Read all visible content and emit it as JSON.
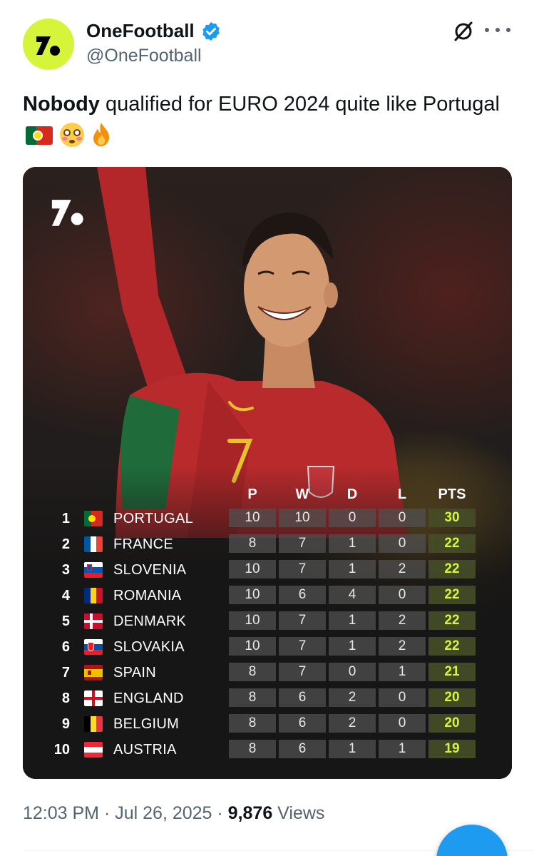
{
  "author": {
    "display_name": "OneFootball",
    "handle": "@OneFootball",
    "verified": true,
    "avatar_icon": "onefootball-logo-icon",
    "brand_color": "#d6f53a"
  },
  "tweet": {
    "bold_word": "Nobody",
    "text": " qualified for EURO 2024 quite like Portugal",
    "emojis": [
      "portugal-flag",
      "flushed-face",
      "fire"
    ]
  },
  "table": {
    "headers": [
      "P",
      "W",
      "D",
      "L",
      "PTS"
    ],
    "rows": [
      {
        "pos": "1",
        "team": "PORTUGAL",
        "flag": "portugal",
        "p": "10",
        "w": "10",
        "d": "0",
        "l": "0",
        "pts": "30"
      },
      {
        "pos": "2",
        "team": "FRANCE",
        "flag": "france",
        "p": "8",
        "w": "7",
        "d": "1",
        "l": "0",
        "pts": "22"
      },
      {
        "pos": "3",
        "team": "SLOVENIA",
        "flag": "slovenia",
        "p": "10",
        "w": "7",
        "d": "1",
        "l": "2",
        "pts": "22"
      },
      {
        "pos": "4",
        "team": "ROMANIA",
        "flag": "romania",
        "p": "10",
        "w": "6",
        "d": "4",
        "l": "0",
        "pts": "22"
      },
      {
        "pos": "5",
        "team": "DENMARK",
        "flag": "denmark",
        "p": "10",
        "w": "7",
        "d": "1",
        "l": "2",
        "pts": "22"
      },
      {
        "pos": "6",
        "team": "SLOVAKIA",
        "flag": "slovakia",
        "p": "10",
        "w": "7",
        "d": "1",
        "l": "2",
        "pts": "22"
      },
      {
        "pos": "7",
        "team": "SPAIN",
        "flag": "spain",
        "p": "8",
        "w": "7",
        "d": "0",
        "l": "1",
        "pts": "21"
      },
      {
        "pos": "8",
        "team": "ENGLAND",
        "flag": "england",
        "p": "8",
        "w": "6",
        "d": "2",
        "l": "0",
        "pts": "20"
      },
      {
        "pos": "9",
        "team": "BELGIUM",
        "flag": "belgium",
        "p": "8",
        "w": "6",
        "d": "2",
        "l": "0",
        "pts": "20"
      },
      {
        "pos": "10",
        "team": "AUSTRIA",
        "flag": "austria",
        "p": "8",
        "w": "6",
        "d": "1",
        "l": "1",
        "pts": "19"
      }
    ]
  },
  "meta": {
    "time": "12:03 PM",
    "separator": " · ",
    "date": "Jul 26, 2025",
    "views_count": "9,876",
    "views_label": " Views"
  },
  "colors": {
    "accent": "#1d9bf0",
    "secondary_text": "#536471",
    "pts_highlight": "#d4f53a"
  }
}
